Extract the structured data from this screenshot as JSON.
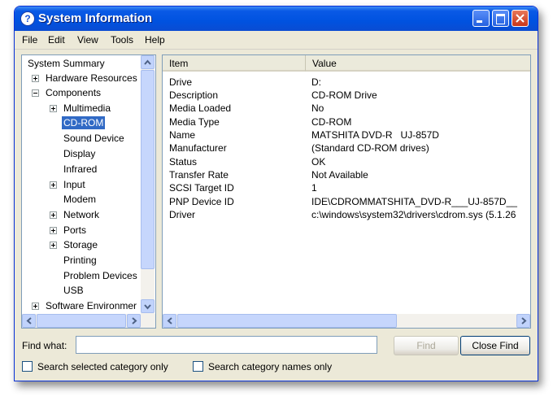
{
  "window": {
    "title": "System Information",
    "app_icon_glyph": "?",
    "controls": {
      "minimize": "minimize-icon",
      "maximize": "maximize-icon",
      "close": "close-icon"
    }
  },
  "menu": [
    {
      "label": "File"
    },
    {
      "label": "Edit"
    },
    {
      "label": "View"
    },
    {
      "label": "Tools"
    },
    {
      "label": "Help"
    }
  ],
  "tree": {
    "items": [
      {
        "label": "System Summary",
        "level": 0,
        "expander": "none"
      },
      {
        "label": "Hardware Resources",
        "level": 1,
        "expander": "plus"
      },
      {
        "label": "Components",
        "level": 1,
        "expander": "minus"
      },
      {
        "label": "Multimedia",
        "level": 2,
        "expander": "plus"
      },
      {
        "label": "CD-ROM",
        "level": 2,
        "expander": "none",
        "selected": true
      },
      {
        "label": "Sound Device",
        "level": 2,
        "expander": "none"
      },
      {
        "label": "Display",
        "level": 2,
        "expander": "none"
      },
      {
        "label": "Infrared",
        "level": 2,
        "expander": "none"
      },
      {
        "label": "Input",
        "level": 2,
        "expander": "plus"
      },
      {
        "label": "Modem",
        "level": 2,
        "expander": "none"
      },
      {
        "label": "Network",
        "level": 2,
        "expander": "plus"
      },
      {
        "label": "Ports",
        "level": 2,
        "expander": "plus"
      },
      {
        "label": "Storage",
        "level": 2,
        "expander": "plus"
      },
      {
        "label": "Printing",
        "level": 2,
        "expander": "none"
      },
      {
        "label": "Problem Devices",
        "level": 2,
        "expander": "none"
      },
      {
        "label": "USB",
        "level": 2,
        "expander": "none"
      },
      {
        "label": "Software Environmer",
        "level": 1,
        "expander": "plus"
      }
    ]
  },
  "details": {
    "columns": [
      "Item",
      "Value"
    ],
    "rows": [
      {
        "item": "Drive",
        "value": "D:"
      },
      {
        "item": "Description",
        "value": "CD-ROM Drive"
      },
      {
        "item": "Media Loaded",
        "value": "No"
      },
      {
        "item": "Media Type",
        "value": "CD-ROM"
      },
      {
        "item": "Name",
        "value": "MATSHITA DVD-R   UJ-857D"
      },
      {
        "item": "Manufacturer",
        "value": "(Standard CD-ROM drives)"
      },
      {
        "item": "Status",
        "value": "OK"
      },
      {
        "item": "Transfer Rate",
        "value": "Not Available"
      },
      {
        "item": "SCSI Target ID",
        "value": "1"
      },
      {
        "item": "PNP Device ID",
        "value": "IDE\\CDROMMATSHITA_DVD-R___UJ-857D__"
      },
      {
        "item": "Driver",
        "value": "c:\\windows\\system32\\drivers\\cdrom.sys (5.1.26"
      }
    ]
  },
  "find": {
    "label": "Find what:",
    "value": "",
    "find_button": "Find",
    "close_button": "Close Find",
    "search_selected": "Search selected category only",
    "search_names": "Search category names only"
  },
  "colors": {
    "title_bar": "#0052e0",
    "selection": "#316ac5",
    "face": "#ece9d8"
  }
}
